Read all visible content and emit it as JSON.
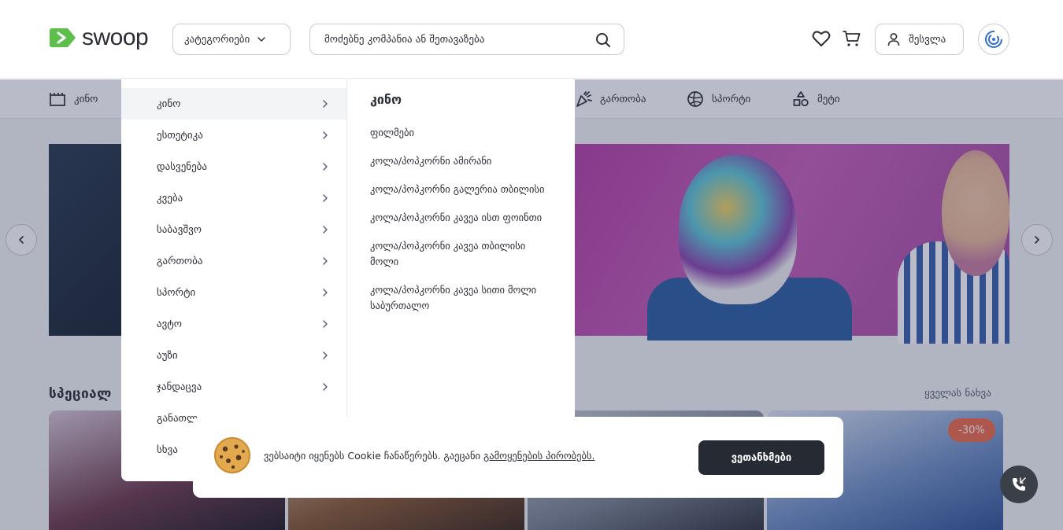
{
  "header": {
    "logo_text": "swoop",
    "categories_label": "კატეგორიები",
    "search_placeholder": "მოძებნე კომპანია ან შეთავაზება",
    "login_label": "შესვლა"
  },
  "catbar": {
    "items": [
      {
        "label": "კინო",
        "icon": "cinema-icon"
      },
      {
        "label": "გართობა",
        "icon": "party-popper-icon"
      },
      {
        "label": "სპორტი",
        "icon": "ball-icon"
      },
      {
        "label": "მეტი",
        "icon": "shapes-icon"
      }
    ]
  },
  "dropdown": {
    "categories": [
      {
        "label": "კინო",
        "active": true
      },
      {
        "label": "ესთეტიკა"
      },
      {
        "label": "დასვენება"
      },
      {
        "label": "კვება"
      },
      {
        "label": "საბავშვო"
      },
      {
        "label": "გართობა"
      },
      {
        "label": "სპორტი"
      },
      {
        "label": "ავტო"
      },
      {
        "label": "აუზი"
      },
      {
        "label": "ჯანდაცვა"
      },
      {
        "label": "განათლ"
      },
      {
        "label": "სხვა"
      }
    ],
    "heading": "კინო",
    "subitems": [
      "ფილმები",
      "კოლა/პოპკორნი ამირანი",
      "კოლა/პოპკორნი გალერია თბილისი",
      "კოლა/პოპკორნი კავეა ისთ ფოინთი",
      "კოლა/პოპკორნი კავეა თბილისი მოლი",
      "კოლა/პოპკორნი კავეა სითი მოლი საბურთალო"
    ]
  },
  "section": {
    "title": "სპეციალ",
    "see_all": "ყველას ნახვა",
    "discount": "-30%"
  },
  "cookie": {
    "text": "ვებსაიტი იყენებს Cookie ჩანაწერებს. გაეცანი ",
    "link": "გამოყენების პირობებს.",
    "agree_label": "ვეთანხმები"
  },
  "colors": {
    "brand_green": "#5bbf4a",
    "dark_button": "#262a33",
    "discount_badge": "#ef6b4a",
    "wallet_blue": "#2f6fd6"
  }
}
